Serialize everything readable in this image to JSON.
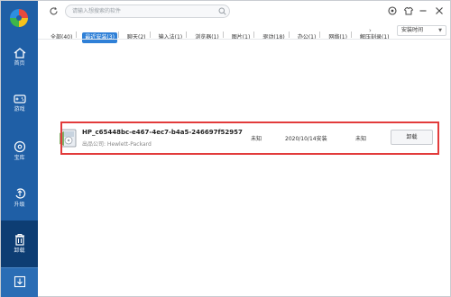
{
  "sidebar": {
    "items": [
      {
        "label": "首页",
        "icon": "home-icon"
      },
      {
        "label": "游戏",
        "icon": "gamepad-icon"
      },
      {
        "label": "宝库",
        "icon": "disc-icon"
      },
      {
        "label": "升级",
        "icon": "upgrade-icon"
      },
      {
        "label": "卸载",
        "icon": "trash-icon"
      }
    ],
    "bottom_icon": "download-icon",
    "active": "卸载",
    "bg_color": "#1f5fa6"
  },
  "search": {
    "placeholder": "请输入想搜索的软件"
  },
  "tabs": [
    {
      "label": "全部(40)"
    },
    {
      "label": "最近安装(3)"
    },
    {
      "label": "聊天(2)"
    },
    {
      "label": "输入法(1)"
    },
    {
      "label": "浏览器(1)"
    },
    {
      "label": "图片(1)"
    },
    {
      "label": "驱动(18)"
    },
    {
      "label": "办公(1)"
    },
    {
      "label": "网络(1)"
    },
    {
      "label": "解压刻录(1)"
    }
  ],
  "active_tab": "最近安装(3)",
  "sort": {
    "value": "安装时间"
  },
  "software_list": [
    {
      "name": "HP_c65448bc-e467-4ec7-b4a5-246697f52957",
      "publisher": "出品公司: Hewlett-Packard",
      "size": "未知",
      "install_date": "2020/10/14安装",
      "usage": "未知",
      "action_label": "卸载"
    }
  ],
  "colors": {
    "accent": "#2f80d7",
    "highlight_border": "#e23b3b"
  }
}
